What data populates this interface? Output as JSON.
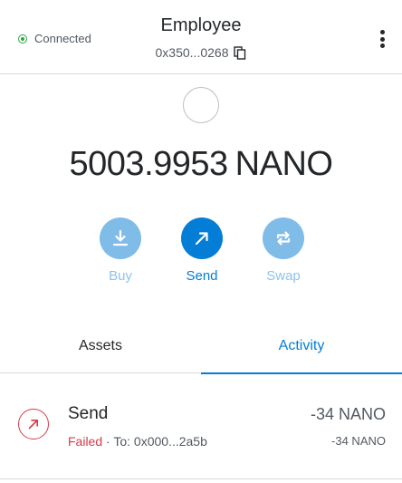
{
  "header": {
    "connection_status": "Connected",
    "account_name": "Employee",
    "account_address": "0x350...0268"
  },
  "balance": {
    "amount": "5003.9953",
    "unit": "NANO"
  },
  "actions": {
    "buy_label": "Buy",
    "send_label": "Send",
    "swap_label": "Swap"
  },
  "tabs": {
    "assets_label": "Assets",
    "activity_label": "Activity",
    "active": "Activity"
  },
  "activity": [
    {
      "title": "Send",
      "status": "Failed",
      "separator": " · ",
      "recipient": "To: 0x000...2a5b",
      "primary_amount": "-34 NANO",
      "secondary_amount": "-34 NANO"
    }
  ],
  "colors": {
    "accent": "#037dd6",
    "accent_light": "#7fbce8",
    "connected": "#28a745",
    "failed": "#d73a49"
  },
  "icons": [
    "connected-dot-icon",
    "copy-icon",
    "kebab-menu-icon",
    "token-icon",
    "download-icon",
    "send-arrow-icon",
    "swap-icon",
    "failed-send-icon"
  ]
}
